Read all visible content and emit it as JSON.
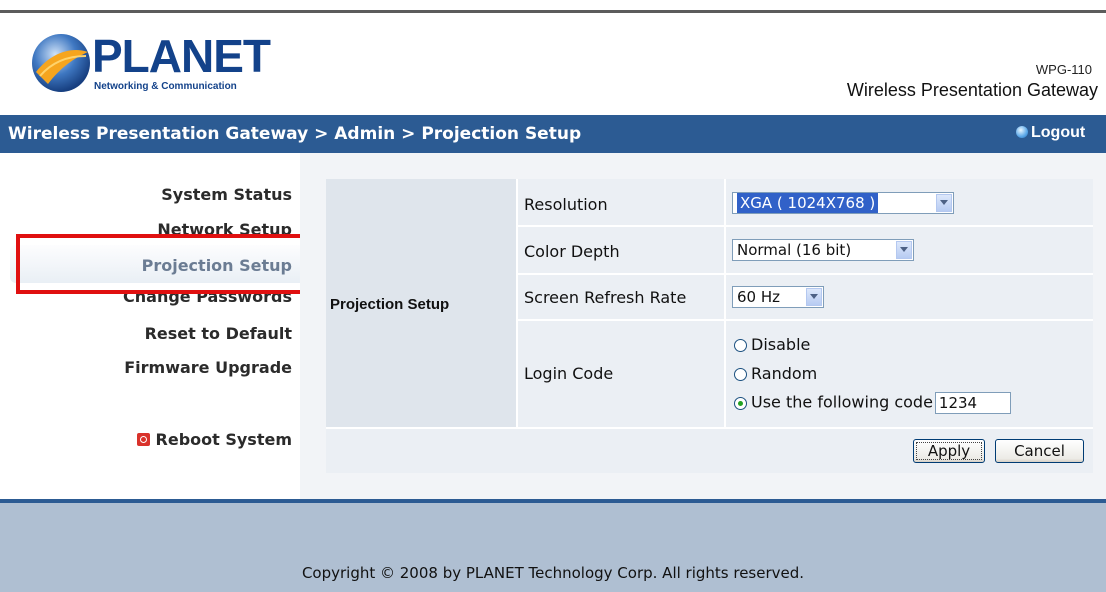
{
  "header": {
    "logo_text": "PLANET",
    "logo_tagline": "Networking & Communication",
    "model": "WPG-110",
    "product_name": "Wireless Presentation Gateway"
  },
  "nav_bar": {
    "breadcrumb": "Wireless Presentation Gateway > Admin > Projection Setup",
    "logout_label": "Logout",
    "color": "#2c5b93"
  },
  "sidebar": {
    "items": [
      {
        "label": "System Status"
      },
      {
        "label": "Network Setup"
      },
      {
        "label": "Projection Setup",
        "active": true
      },
      {
        "label": "Change Passwords"
      },
      {
        "label": "Reset to Default"
      },
      {
        "label": "Firmware Upgrade"
      }
    ],
    "reboot_label": "Reboot System"
  },
  "form": {
    "group_label": "Projection Setup",
    "resolution": {
      "label": "Resolution",
      "value": "XGA ( 1024X768 )"
    },
    "color_depth": {
      "label": "Color Depth",
      "value": "Normal (16 bit)"
    },
    "refresh_rate": {
      "label": "Screen Refresh Rate",
      "value": "60 Hz"
    },
    "login_code": {
      "label": "Login Code",
      "options": [
        "Disable",
        "Random",
        "Use the following code"
      ],
      "selected": "Use the following code",
      "code_value": "1234"
    },
    "apply_label": "Apply",
    "cancel_label": "Cancel"
  },
  "footer": {
    "copyright": "Copyright © 2008 by PLANET Technology Corp. All rights reserved."
  },
  "colors": {
    "highlight_box": "#e01010",
    "footer_bg": "#afbfd2"
  }
}
